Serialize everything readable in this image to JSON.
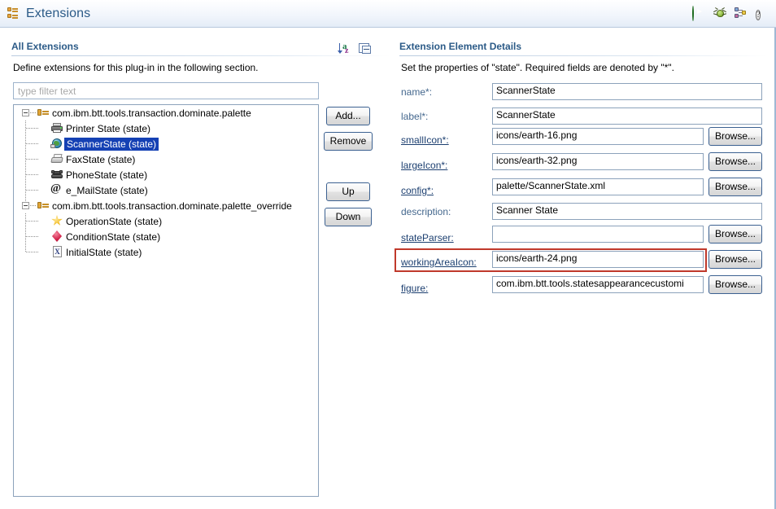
{
  "window": {
    "title": "Extensions",
    "title_icon": "extension-plug-icon"
  },
  "header_tools": [
    {
      "name": "run-icon",
      "tooltip": "Run"
    },
    {
      "name": "debug-icon",
      "tooltip": "Debug"
    },
    {
      "name": "extensions-icon",
      "tooltip": "Extensions"
    },
    {
      "name": "help-icon",
      "tooltip": "Help",
      "glyph": "?"
    }
  ],
  "left_section": {
    "title": "All Extensions",
    "description": "Define extensions for this plug-in in the following section.",
    "tools": [
      {
        "name": "sort-az-icon",
        "a": "a",
        "z": "z"
      },
      {
        "name": "collapse-all-icon"
      }
    ],
    "filter": {
      "placeholder": "type filter text",
      "value": ""
    },
    "tree": [
      {
        "label": "com.ibm.btt.tools.transaction.dominate.palette",
        "icon": "plug-icon",
        "expanded": true,
        "selected": false,
        "children": [
          {
            "label": "Printer State (state)",
            "icon": "printer-icon",
            "selected": false
          },
          {
            "label": "ScannerState (state)",
            "icon": "scanner-globe-icon",
            "selected": true
          },
          {
            "label": "FaxState (state)",
            "icon": "fax-icon",
            "selected": false
          },
          {
            "label": "PhoneState (state)",
            "icon": "phone-icon",
            "selected": false
          },
          {
            "label": "e_MailState (state)",
            "icon": "at-mail-icon",
            "selected": false
          }
        ]
      },
      {
        "label": "com.ibm.btt.tools.transaction.dominate.palette_override",
        "icon": "plug-icon",
        "expanded": true,
        "selected": false,
        "children": [
          {
            "label": "OperationState (state)",
            "icon": "star-icon",
            "selected": false
          },
          {
            "label": "ConditionState (state)",
            "icon": "diamond-icon",
            "selected": false
          },
          {
            "label": "InitialState (state)",
            "icon": "x-file-icon",
            "glyph": "X",
            "selected": false
          }
        ]
      }
    ]
  },
  "middle_buttons": [
    {
      "label": "Add...",
      "name": "add-button"
    },
    {
      "label": "Remove",
      "name": "remove-button"
    },
    {
      "label": "Up",
      "name": "up-button"
    },
    {
      "label": "Down",
      "name": "down-button"
    }
  ],
  "right_section": {
    "title": "Extension Element Details",
    "description": "Set the properties of \"state\". Required fields are denoted by \"*\".",
    "browse_label": "Browse...",
    "fields": [
      {
        "label": "name*:",
        "value": "ScannerState",
        "link": false,
        "browse": false,
        "highlighted": false
      },
      {
        "label": "label*:",
        "value": "ScannerState",
        "link": false,
        "browse": false,
        "highlighted": false
      },
      {
        "label": "smallIcon*:",
        "value": "icons/earth-16.png",
        "link": true,
        "browse": true,
        "highlighted": false
      },
      {
        "label": "largeIcon*:",
        "value": "icons/earth-32.png",
        "link": true,
        "browse": true,
        "highlighted": false
      },
      {
        "label": "config*:",
        "value": "palette/ScannerState.xml",
        "link": true,
        "browse": true,
        "highlighted": false
      },
      {
        "label": "description:",
        "value": "Scanner State",
        "link": false,
        "browse": false,
        "highlighted": false
      },
      {
        "label": "stateParser:",
        "value": "",
        "link": true,
        "browse": true,
        "highlighted": false
      },
      {
        "label": "workingAreaIcon:",
        "value": "icons/earth-24.png",
        "link": true,
        "browse": true,
        "highlighted": true
      },
      {
        "label": "figure:",
        "value": "com.ibm.btt.tools.statesappearancecustomi",
        "link": true,
        "browse": true,
        "highlighted": false
      }
    ]
  },
  "colors": {
    "header_text": "#2b5a87",
    "section_title": "#2b5a87",
    "label": "#45688e",
    "link_label": "#1c3f70",
    "selection": "#1541b4",
    "highlight": "#c0392b",
    "panel_border": "#8ca2bb"
  }
}
